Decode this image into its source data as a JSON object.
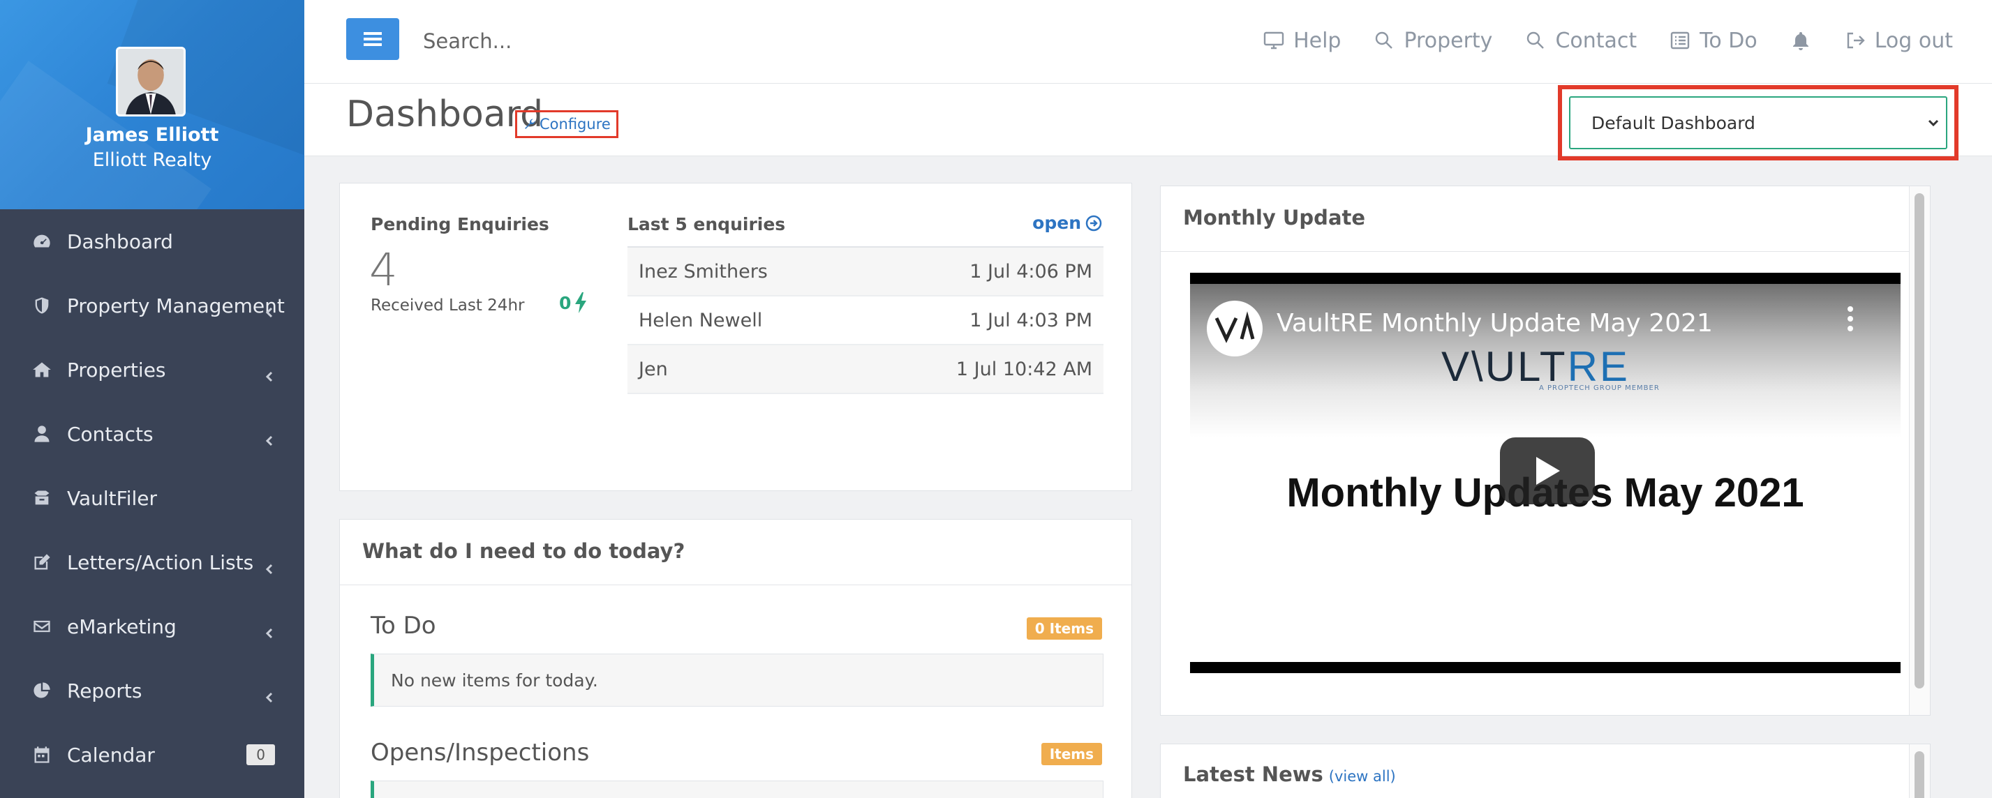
{
  "user": {
    "name": "James Elliott",
    "company": "Elliott Realty"
  },
  "sidebar": {
    "items": [
      {
        "label": "Dashboard",
        "icon": "dashboard-icon",
        "has_children": false
      },
      {
        "label": "Property Management",
        "icon": "shield-icon",
        "has_children": true
      },
      {
        "label": "Properties",
        "icon": "home-icon",
        "has_children": true
      },
      {
        "label": "Contacts",
        "icon": "user-icon",
        "has_children": true
      },
      {
        "label": "VaultFiler",
        "icon": "box-icon",
        "has_children": false
      },
      {
        "label": "Letters/Action Lists",
        "icon": "edit-icon",
        "has_children": true
      },
      {
        "label": "eMarketing",
        "icon": "envelope-icon",
        "has_children": true
      },
      {
        "label": "Reports",
        "icon": "pie-chart-icon",
        "has_children": true
      },
      {
        "label": "Calendar",
        "icon": "calendar-icon",
        "badge": "0"
      }
    ]
  },
  "topbar": {
    "search_placeholder": "Search...",
    "links": {
      "help": "Help",
      "property": "Property",
      "contact": "Contact",
      "todo": "To Do",
      "logout": "Log out"
    }
  },
  "header": {
    "title": "Dashboard",
    "configure": "Configure",
    "dashboard_select": "Default Dashboard"
  },
  "enquiries": {
    "title": "Pending Enquiries",
    "count": "4",
    "subtitle": "Received Last 24hr",
    "last24": "0",
    "last5_title": "Last 5 enquiries",
    "open_label": "open",
    "rows": [
      {
        "name": "Inez Smithers",
        "time": "1 Jul 4:06 PM"
      },
      {
        "name": "Helen Newell",
        "time": "1 Jul 4:03 PM"
      },
      {
        "name": "Jen",
        "time": "1 Jul 10:42 AM"
      }
    ]
  },
  "today": {
    "title": "What do I need to do today?",
    "todo_title": "To Do",
    "todo_badge": "0 Items",
    "todo_notice": "No new items for today.",
    "opens_title": "Opens/Inspections",
    "opens_badge": "Items"
  },
  "monthly": {
    "title": "Monthly Update",
    "video_title": "VaultRE Monthly Update May 2021",
    "logo_text_a": "V\\ULT",
    "logo_text_b": "RE",
    "logo_sub": "A PROPTECH GROUP MEMBER",
    "headline": "Monthly Updates May 2021"
  },
  "news": {
    "title": "Latest News",
    "view_all": "(view all)"
  },
  "colors": {
    "sidebar": "#3a4356",
    "profile": "#2e85d6",
    "accent": "#3d8fe0",
    "green": "#2aa67e",
    "orange": "#f0ad4e",
    "highlight": "#e23a2a"
  }
}
